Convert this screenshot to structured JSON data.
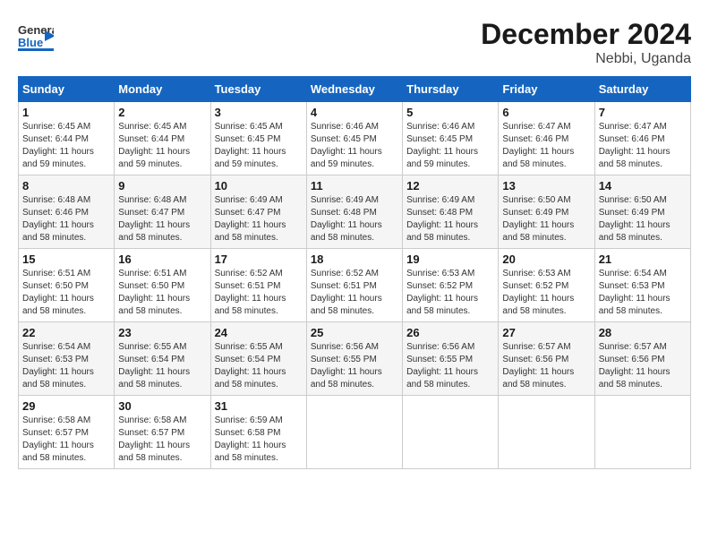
{
  "header": {
    "logo_general": "General",
    "logo_blue": "Blue",
    "title": "December 2024",
    "subtitle": "Nebbi, Uganda"
  },
  "days_of_week": [
    "Sunday",
    "Monday",
    "Tuesday",
    "Wednesday",
    "Thursday",
    "Friday",
    "Saturday"
  ],
  "weeks": [
    [
      {
        "day": "1",
        "sunrise": "6:45 AM",
        "sunset": "6:44 PM",
        "daylight": "11 hours and 59 minutes."
      },
      {
        "day": "2",
        "sunrise": "6:45 AM",
        "sunset": "6:44 PM",
        "daylight": "11 hours and 59 minutes."
      },
      {
        "day": "3",
        "sunrise": "6:45 AM",
        "sunset": "6:45 PM",
        "daylight": "11 hours and 59 minutes."
      },
      {
        "day": "4",
        "sunrise": "6:46 AM",
        "sunset": "6:45 PM",
        "daylight": "11 hours and 59 minutes."
      },
      {
        "day": "5",
        "sunrise": "6:46 AM",
        "sunset": "6:45 PM",
        "daylight": "11 hours and 59 minutes."
      },
      {
        "day": "6",
        "sunrise": "6:47 AM",
        "sunset": "6:46 PM",
        "daylight": "11 hours and 58 minutes."
      },
      {
        "day": "7",
        "sunrise": "6:47 AM",
        "sunset": "6:46 PM",
        "daylight": "11 hours and 58 minutes."
      }
    ],
    [
      {
        "day": "8",
        "sunrise": "6:48 AM",
        "sunset": "6:46 PM",
        "daylight": "11 hours and 58 minutes."
      },
      {
        "day": "9",
        "sunrise": "6:48 AM",
        "sunset": "6:47 PM",
        "daylight": "11 hours and 58 minutes."
      },
      {
        "day": "10",
        "sunrise": "6:49 AM",
        "sunset": "6:47 PM",
        "daylight": "11 hours and 58 minutes."
      },
      {
        "day": "11",
        "sunrise": "6:49 AM",
        "sunset": "6:48 PM",
        "daylight": "11 hours and 58 minutes."
      },
      {
        "day": "12",
        "sunrise": "6:49 AM",
        "sunset": "6:48 PM",
        "daylight": "11 hours and 58 minutes."
      },
      {
        "day": "13",
        "sunrise": "6:50 AM",
        "sunset": "6:49 PM",
        "daylight": "11 hours and 58 minutes."
      },
      {
        "day": "14",
        "sunrise": "6:50 AM",
        "sunset": "6:49 PM",
        "daylight": "11 hours and 58 minutes."
      }
    ],
    [
      {
        "day": "15",
        "sunrise": "6:51 AM",
        "sunset": "6:50 PM",
        "daylight": "11 hours and 58 minutes."
      },
      {
        "day": "16",
        "sunrise": "6:51 AM",
        "sunset": "6:50 PM",
        "daylight": "11 hours and 58 minutes."
      },
      {
        "day": "17",
        "sunrise": "6:52 AM",
        "sunset": "6:51 PM",
        "daylight": "11 hours and 58 minutes."
      },
      {
        "day": "18",
        "sunrise": "6:52 AM",
        "sunset": "6:51 PM",
        "daylight": "11 hours and 58 minutes."
      },
      {
        "day": "19",
        "sunrise": "6:53 AM",
        "sunset": "6:52 PM",
        "daylight": "11 hours and 58 minutes."
      },
      {
        "day": "20",
        "sunrise": "6:53 AM",
        "sunset": "6:52 PM",
        "daylight": "11 hours and 58 minutes."
      },
      {
        "day": "21",
        "sunrise": "6:54 AM",
        "sunset": "6:53 PM",
        "daylight": "11 hours and 58 minutes."
      }
    ],
    [
      {
        "day": "22",
        "sunrise": "6:54 AM",
        "sunset": "6:53 PM",
        "daylight": "11 hours and 58 minutes."
      },
      {
        "day": "23",
        "sunrise": "6:55 AM",
        "sunset": "6:54 PM",
        "daylight": "11 hours and 58 minutes."
      },
      {
        "day": "24",
        "sunrise": "6:55 AM",
        "sunset": "6:54 PM",
        "daylight": "11 hours and 58 minutes."
      },
      {
        "day": "25",
        "sunrise": "6:56 AM",
        "sunset": "6:55 PM",
        "daylight": "11 hours and 58 minutes."
      },
      {
        "day": "26",
        "sunrise": "6:56 AM",
        "sunset": "6:55 PM",
        "daylight": "11 hours and 58 minutes."
      },
      {
        "day": "27",
        "sunrise": "6:57 AM",
        "sunset": "6:56 PM",
        "daylight": "11 hours and 58 minutes."
      },
      {
        "day": "28",
        "sunrise": "6:57 AM",
        "sunset": "6:56 PM",
        "daylight": "11 hours and 58 minutes."
      }
    ],
    [
      {
        "day": "29",
        "sunrise": "6:58 AM",
        "sunset": "6:57 PM",
        "daylight": "11 hours and 58 minutes."
      },
      {
        "day": "30",
        "sunrise": "6:58 AM",
        "sunset": "6:57 PM",
        "daylight": "11 hours and 58 minutes."
      },
      {
        "day": "31",
        "sunrise": "6:59 AM",
        "sunset": "6:58 PM",
        "daylight": "11 hours and 58 minutes."
      },
      null,
      null,
      null,
      null
    ]
  ]
}
